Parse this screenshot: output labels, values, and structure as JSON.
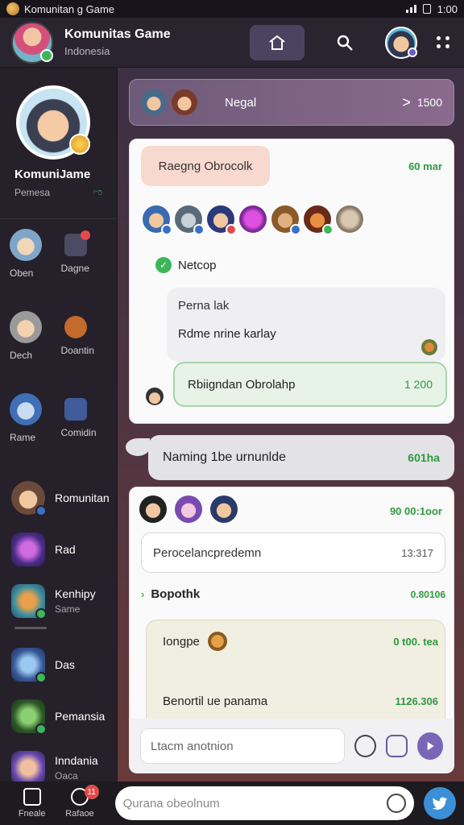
{
  "status": {
    "app_name": "Komunitan g Game",
    "time": "1:00"
  },
  "header": {
    "title": "Komunitas Game",
    "subtitle": "Indonesia"
  },
  "sidebar": {
    "profile": {
      "name": "KomuniJame",
      "sub": "Pemesa",
      "online": "ಌ"
    },
    "grid": [
      {
        "label": "Oben",
        "badge_label": "Dagne"
      },
      {
        "label": "Dech",
        "badge_label": "Doantin"
      },
      {
        "label": "Rame",
        "badge_label": "Comidin"
      }
    ],
    "list": [
      {
        "title": "Romunitan",
        "sub": ""
      },
      {
        "title": "Rad",
        "sub": ""
      },
      {
        "title": "Kenhipy",
        "sub": "Same"
      },
      {
        "title": "Das",
        "sub": ""
      },
      {
        "title": "Pemansia",
        "sub": ""
      },
      {
        "title": "Inndania",
        "sub": "Oaca"
      }
    ]
  },
  "banner": {
    "title": "Negal",
    "count": "1500",
    "chevron": ">"
  },
  "card1": {
    "pill": "Raegng Obrocolk",
    "time": "60 mar",
    "verify": "Netcop",
    "quote_line1": "Perna lak",
    "quote_line2": "Rdme nrine karlay",
    "reply": "Rbiigndan Obrolahp",
    "reply_time": "1 200"
  },
  "bubble": {
    "text": "Naming 1be urnunlde",
    "time": "601ha"
  },
  "card2": {
    "time": "90 00:1oor",
    "field": "Perocelancpredemn",
    "field_time": "13:317",
    "section": "Bopothk",
    "section_time": "0.80106",
    "panel_row1": "Iongpe",
    "panel_row1_time": "0 t00. tea",
    "panel_row2": "Benortil ue panama",
    "panel_row2_time": "1126.306"
  },
  "composer": {
    "placeholder": "Ltacm anotnion"
  },
  "bottom": {
    "nav1": "Fneale",
    "nav2": "Rafaoe",
    "notif": "11",
    "search_placeholder": "Qurana obeolnum"
  },
  "colors": {
    "accent_green": "#2d9a3e",
    "accent_purple": "#7a66b6",
    "send_blue": "#3a8fd6"
  }
}
